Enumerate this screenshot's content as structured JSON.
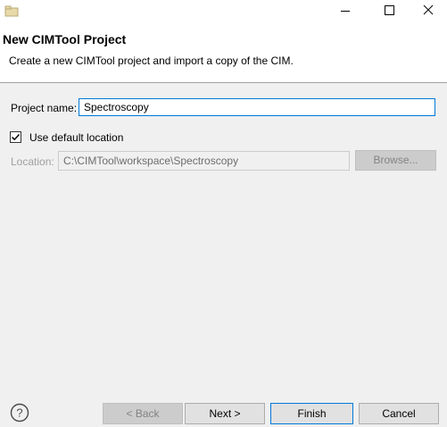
{
  "window": {
    "icon": "folder-icon",
    "controls": [
      "minimize-icon",
      "maximize-icon",
      "close-icon"
    ]
  },
  "header": {
    "title": "New CIMTool Project",
    "description": "Create a new CIMTool project and import a copy of the CIM."
  },
  "form": {
    "project_name_label": "Project name:",
    "project_name_value": "Spectroscopy",
    "use_default_label": "Use default location",
    "use_default_checked": true,
    "location_label": "Location:",
    "location_value": "C:\\CIMTool\\workspace\\Spectroscopy",
    "browse_label": "Browse..."
  },
  "footer": {
    "help_icon": "help-icon",
    "back_label": "< Back",
    "next_label": "Next >",
    "finish_label": "Finish",
    "cancel_label": "Cancel"
  },
  "colors": {
    "focus_border": "#0078d7",
    "disabled_text": "#838383",
    "background": "#f0f0f0"
  }
}
